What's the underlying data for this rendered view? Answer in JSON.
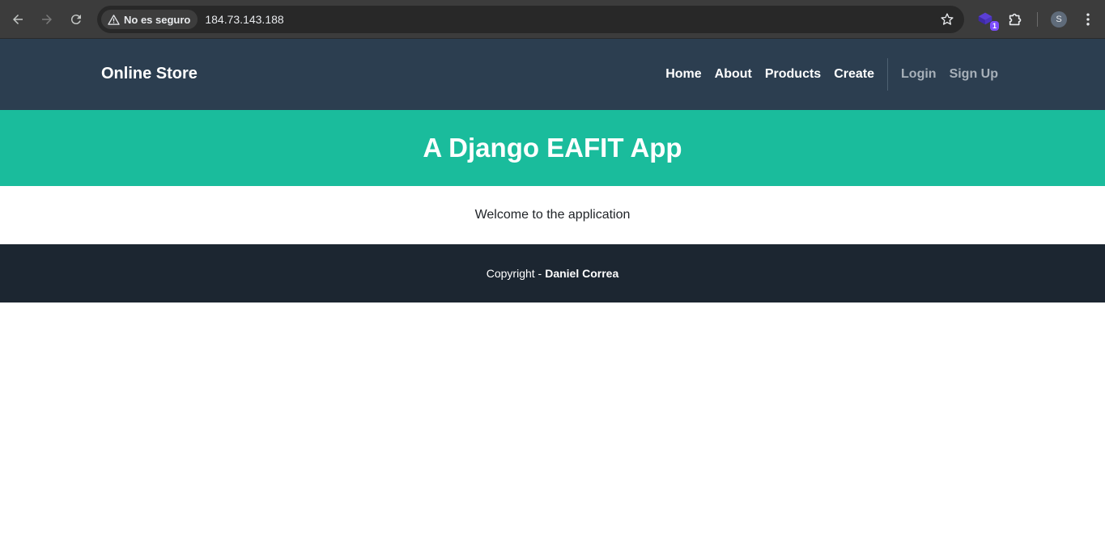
{
  "browser": {
    "security_label": "No es seguro",
    "url": "184.73.143.188",
    "extension_badge": "1",
    "profile_initial": "S",
    "icons": [
      "back-icon",
      "forward-icon",
      "reload-icon",
      "warning-icon",
      "star-icon",
      "extension-icon",
      "puzzle-icon",
      "kebab-menu-icon"
    ]
  },
  "site": {
    "brand": "Online Store",
    "nav": {
      "home": "Home",
      "about": "About",
      "products": "Products",
      "create": "Create",
      "login": "Login",
      "signup": "Sign Up"
    },
    "hero_title": "A Django EAFIT App",
    "welcome": "Welcome to the application",
    "footer": {
      "prefix": "Copyright -",
      "author": "Daniel Correa"
    }
  },
  "colors": {
    "nav_bg": "#2c3e50",
    "hero_bg": "#1abc9c",
    "footer_bg": "#1c2631"
  }
}
